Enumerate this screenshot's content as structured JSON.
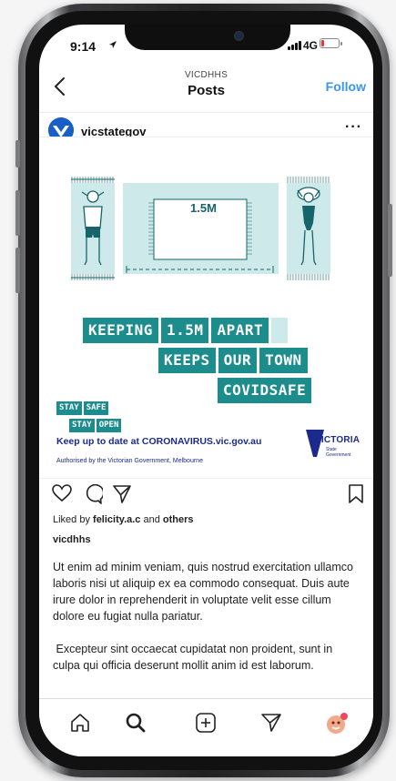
{
  "status_bar": {
    "time": "9:14",
    "network": "4G",
    "battery_percent": 15
  },
  "header": {
    "subtitle": "VICDHHS",
    "title": "Posts",
    "follow_label": "Follow"
  },
  "post": {
    "username": "vicstategov",
    "graphic": {
      "distance": "1.5M",
      "line1": [
        "KEEPING",
        "1.5M",
        "APART"
      ],
      "line2": [
        "KEEPS",
        "OUR",
        "TOWN"
      ],
      "line3": [
        "COVIDSAFE"
      ],
      "stay1": [
        "STAY",
        "SAFE"
      ],
      "stay2": [
        "STAY",
        "OPEN"
      ],
      "keep_up": "Keep up to date at CORONAVIRUS.vic.gov.au",
      "authorised": "Authorised by the Victorian Government, Melbourne",
      "logo_text": "VICTORIA",
      "logo_sub1": "State",
      "logo_sub2": "Government"
    },
    "likes": {
      "prefix": "Liked by ",
      "user": "felicity.a.c",
      "middle": " and ",
      "others": "others"
    },
    "author": "vicdhhs",
    "caption": [
      "Ut enim ad minim veniam, quis nostrud exercitation ullamco laboris nisi ut aliquip ex ea commodo consequat. Duis aute irure dolor in reprehenderit in voluptate velit esse cillum dolore eu fugiat nulla pariatur.",
      " Excepteur sint occaecat cupidatat non proident, sunt in culpa qui officia deserunt mollit anim id est laborum."
    ]
  },
  "tabbar": {
    "items": [
      "home-icon",
      "search-icon",
      "new-post-icon",
      "direct-message-icon",
      "profile-avatar"
    ]
  },
  "colors": {
    "accent": "#3897f0",
    "teal": "#1d8c8c",
    "navy": "#1b2a8c",
    "battery": "#ff2d2d"
  }
}
